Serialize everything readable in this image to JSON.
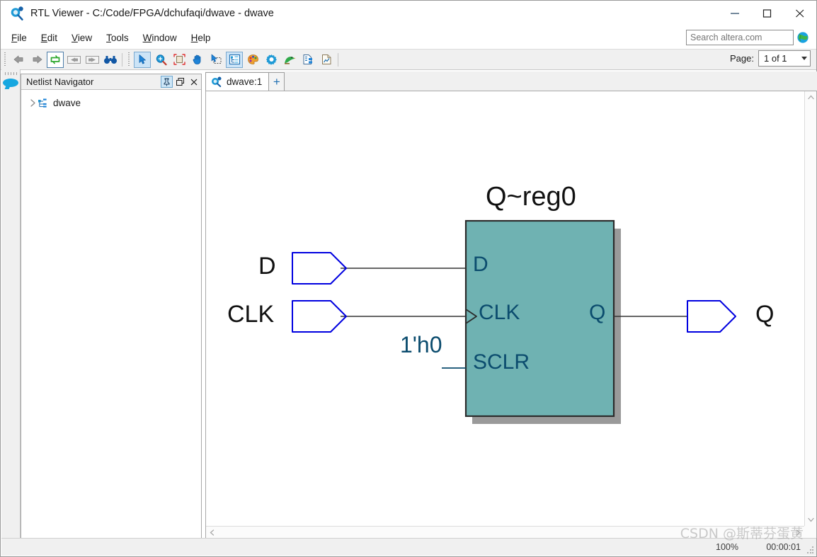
{
  "window": {
    "title": "RTL Viewer - C:/Code/FPGA/dchufaqi/dwave - dwave",
    "icon": "rtl-viewer-icon",
    "buttons": {
      "minimize": "minimize",
      "maximize": "maximize",
      "close": "close"
    }
  },
  "menubar": {
    "items": [
      {
        "label": "File",
        "mnemonic": "F"
      },
      {
        "label": "Edit",
        "mnemonic": "E"
      },
      {
        "label": "View",
        "mnemonic": "V"
      },
      {
        "label": "Tools",
        "mnemonic": "T"
      },
      {
        "label": "Window",
        "mnemonic": "W"
      },
      {
        "label": "Help",
        "mnemonic": "H"
      }
    ]
  },
  "search": {
    "placeholder": "Search altera.com",
    "value": "",
    "globe_icon": "globe-icon"
  },
  "toolbar": {
    "groups": [
      {
        "icons": [
          "back-arrow-icon",
          "forward-arrow-icon",
          "refresh-icon",
          "previous-page-icon",
          "next-page-icon",
          "find-binoculars-icon"
        ]
      },
      {
        "icons": [
          "select-cursor-icon",
          "zoom-in-icon",
          "fit-to-page-icon",
          "pan-hand-icon",
          "rubber-band-select-icon",
          "netlist-navigator-icon",
          "color-palette-icon",
          "settings-gear-icon",
          "bird-icon",
          "hierarchy-icon",
          "report-icon"
        ]
      }
    ]
  },
  "page": {
    "label": "Page:",
    "value": "1 of 1"
  },
  "dock": {
    "icon": "message-bubble-icon"
  },
  "navigator": {
    "title": "Netlist Navigator",
    "buttons": {
      "pin": "pin-icon",
      "float": "float-icon",
      "close": "close-icon"
    },
    "tree": [
      {
        "label": "dwave",
        "expanded": false,
        "icon": "netlist-node-icon"
      }
    ]
  },
  "tabs": {
    "items": [
      {
        "label": "dwave:1",
        "icon": "rtl-viewer-icon",
        "active": true
      }
    ],
    "add_label": "+"
  },
  "schematic": {
    "block": {
      "name": "Q~reg0",
      "fill_color": "#6fb2b2",
      "border_color": "#2b2b2b",
      "shadow_color": "#9a9a9a",
      "label_color": "#0b4c6e",
      "input_pins": [
        "D",
        "CLK",
        "SCLR"
      ],
      "output_pins": [
        "Q"
      ],
      "clock_pin": "CLK"
    },
    "input_ports": [
      {
        "label": "D"
      },
      {
        "label": "CLK"
      }
    ],
    "output_ports": [
      {
        "label": "Q"
      }
    ],
    "constants": [
      {
        "value": "1'h0",
        "target_pin": "SCLR"
      }
    ],
    "port_border_color": "#0000e0",
    "wire_color": "#333333"
  },
  "status": {
    "zoom": "100%",
    "time": "00:00:01"
  },
  "watermark": {
    "text": "CSDN @斯蒂芬蛋黄"
  }
}
